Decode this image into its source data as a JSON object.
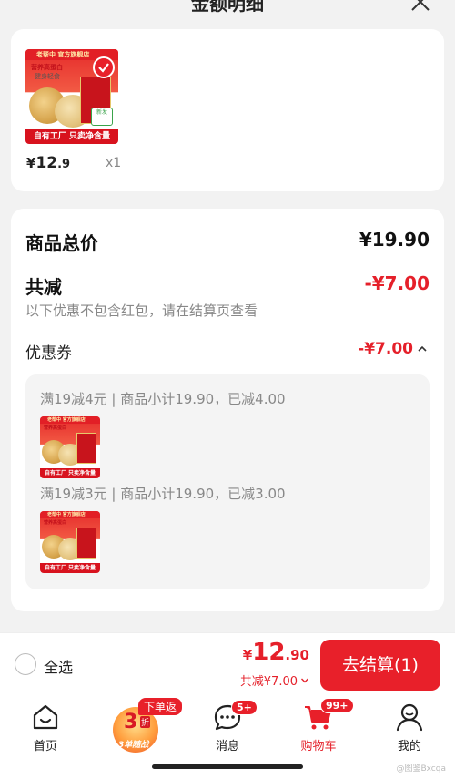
{
  "sheet": {
    "title": "金额明细"
  },
  "product": {
    "thumb_topline": "老帮中 官方旗舰店",
    "thumb_tag1": "营养高蛋白",
    "thumb_tag2": "健身轻食",
    "thumb_band": "自有工厂 只卖净含量",
    "new_badge": "新发",
    "price_yen": "¥",
    "price_int": "12",
    "price_dec": ".9",
    "qty": "x1"
  },
  "summary": {
    "total_label": "商品总价",
    "total_value": "¥19.90",
    "reduce_label": "共减",
    "reduce_value": "-¥7.00",
    "note": "以下优惠不包含红包，请在结算页查看",
    "coupon_label": "优惠券",
    "coupon_value": "-¥7.00",
    "coupons": [
      {
        "text": "满19减4元 | 商品小计19.90，已减4.00"
      },
      {
        "text": "满19减3元 | 商品小计19.90，已减3.00"
      }
    ]
  },
  "action_bar": {
    "select_all": "全选",
    "price_yen": "¥",
    "price_int": "12",
    "price_dec": ".90",
    "reduce_text": "共减¥7.00",
    "checkout": "去结算(1)"
  },
  "tabs": {
    "home": "首页",
    "promo_number": "3",
    "promo_zhe": "折",
    "promo_text": "3单随战",
    "promo_tag": "下单返",
    "messages": "消息",
    "messages_badge": "5+",
    "cart": "购物车",
    "cart_badge": "99+",
    "mine": "我的"
  },
  "colors": {
    "accent": "#e8202a",
    "text": "#222222",
    "muted": "#888888"
  },
  "watermark": "@图鉴Bxcqa"
}
